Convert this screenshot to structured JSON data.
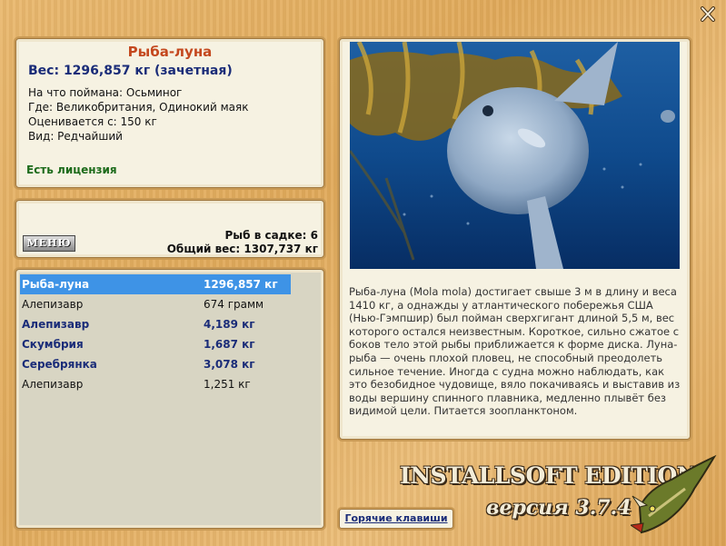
{
  "fish": {
    "name": "Рыба-луна",
    "weight_line": "Вес: 1296,857 кг (зачетная)",
    "bait_line": "На что поймана: Осьминог",
    "location_line": "Где: Великобритания, Одинокий маяк",
    "value_line": "Оценивается с: 150 кг",
    "kind_line": "Вид: Редчайший",
    "license": "Есть лицензия"
  },
  "cage": {
    "menu_label": "МЕНЮ",
    "count_line": "Рыб в садке: 6",
    "total_line": "Общий вес: 1307,737 кг"
  },
  "catch_list": [
    {
      "name": "Рыба-луна",
      "weight": "1296,857 кг",
      "style": "selected"
    },
    {
      "name": "Алепизавр",
      "weight": "674 грамм",
      "style": "normal"
    },
    {
      "name": "Алепизавр",
      "weight": "4,189 кг",
      "style": "bold"
    },
    {
      "name": "Скумбрия",
      "weight": "1,687 кг",
      "style": "bold"
    },
    {
      "name": "Серебрянка",
      "weight": "3,078 кг",
      "style": "bold"
    },
    {
      "name": "Алепизавр",
      "weight": "1,251 кг",
      "style": "normal"
    }
  ],
  "info": {
    "description": "Рыба-луна (Mola mola) достигает свыше 3 м в длину и веса 1410 кг, а однажды у атлантического побережья США (Нью-Гэмпшир) был пойман сверхгигант длиной 5,5 м, вес которого остался неизвестным. Короткое, сильно сжатое с боков тело этой рыбы приближается к форме диска. Луна-рыба — очень плохой пловец, не способный преодолеть сильное течение. Иногда с судна можно наблюдать, как это безобидное чудовище, вяло покачиваясь и выставив из воды вершину спинного плавника, медленно плывёт без видимой цели. Питается зоопланктоном."
  },
  "footer": {
    "hotkeys_label": "Горячие клавиши",
    "edition": "INSTALLSOFT EDITION",
    "version": "версия 3.7.4"
  },
  "icons": {
    "close": "close-icon",
    "photo": "sunfish-photo",
    "logo": "pike-logo-icon"
  },
  "colors": {
    "title": "#c4481e",
    "accent": "#1a2c78",
    "license": "#1d6b1b",
    "selection": "#3e93e6"
  }
}
